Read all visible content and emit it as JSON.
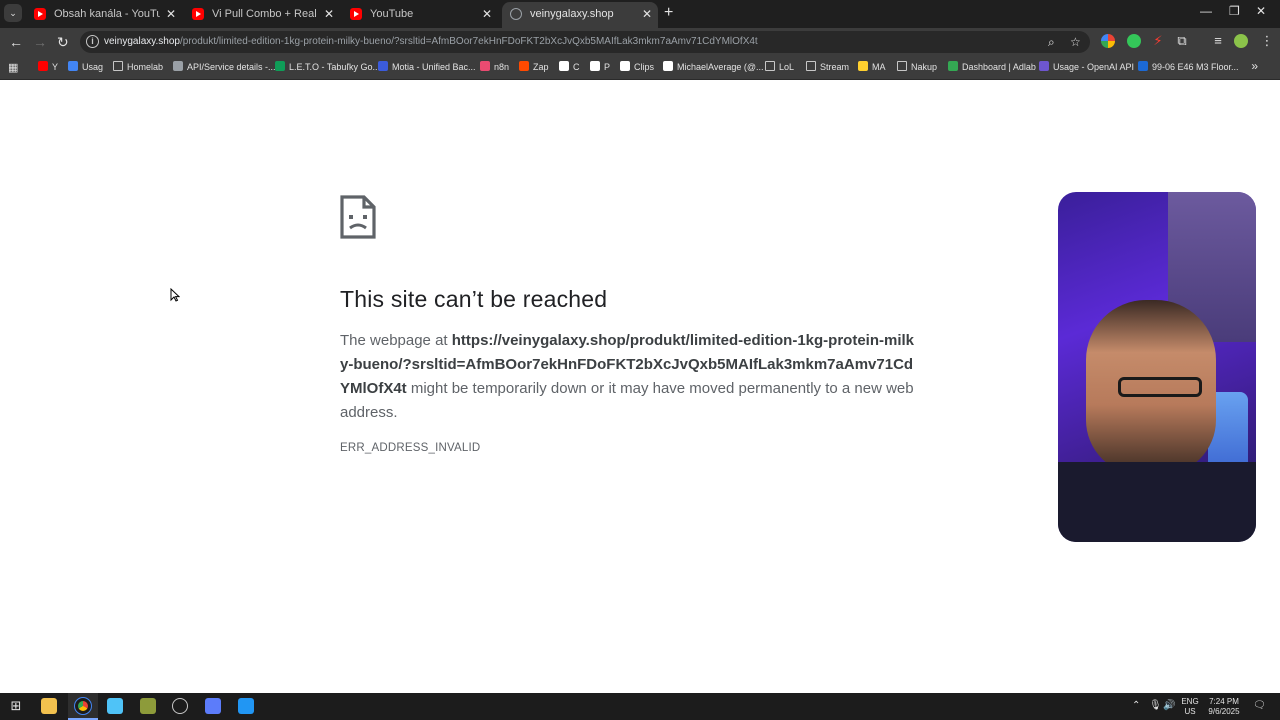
{
  "tabs": [
    {
      "title": "Obsah kanála - YouTube Studio",
      "icon": "youtube-icon"
    },
    {
      "title": "Vi Pull Combo + Real Talk - YouTube",
      "icon": "youtube-icon"
    },
    {
      "title": "YouTube",
      "icon": "youtube-icon"
    },
    {
      "title": "veinygalaxy.shop",
      "icon": "globe-icon",
      "active": true
    }
  ],
  "omnibox": {
    "host": "veinygalaxy.shop",
    "path": "/produkt/limited-edition-1kg-protein-milky-bueno/?srsltid=AfmBOor7ekHnFDoFKT2bXcJvQxb5MAIfLak3mkm7aAmv71CdYMlOfX4t"
  },
  "bookmarks": [
    {
      "label": "Y",
      "icon": "youtube-icon",
      "color": "#ff0000"
    },
    {
      "label": "Usag",
      "icon": "globe-icon",
      "color": "#4285f4"
    },
    {
      "label": "Homelab",
      "icon": "folder-icon"
    },
    {
      "label": "API/Service details -...",
      "icon": "gear-icon",
      "color": "#9aa0a6"
    },
    {
      "label": "L.E.T.O - Tabuľky Go...",
      "icon": "sheets-icon",
      "color": "#0f9d58"
    },
    {
      "label": "Motia - Unified Bac...",
      "icon": "motia-icon",
      "color": "#3b5bdb"
    },
    {
      "label": "n8n",
      "icon": "n8n-icon",
      "color": "#ea4b71"
    },
    {
      "label": "Zap",
      "icon": "zapier-icon",
      "color": "#ff4a00"
    },
    {
      "label": "C",
      "icon": "c-icon",
      "color": "#ffffff"
    },
    {
      "label": "P",
      "icon": "p-icon",
      "color": "#ffffff"
    },
    {
      "label": "Clips",
      "icon": "clips-icon",
      "color": "#ffffff"
    },
    {
      "label": "MichaelAverage (@...",
      "icon": "tiktok-icon",
      "color": "#ffffff"
    },
    {
      "label": "LoL",
      "icon": "folder-icon"
    },
    {
      "label": "Stream",
      "icon": "folder-icon"
    },
    {
      "label": "MA",
      "icon": "miro-icon",
      "color": "#ffd02f"
    },
    {
      "label": "Nakup",
      "icon": "folder-icon"
    },
    {
      "label": "Dashboard | Adlab",
      "icon": "adlab-icon",
      "color": "#34a853"
    },
    {
      "label": "Usage - OpenAI API",
      "icon": "openai-icon",
      "color": "#6e56cf"
    },
    {
      "label": "99-06 E46 M3 Floor...",
      "icon": "bmw-icon",
      "color": "#1c69d4"
    }
  ],
  "error": {
    "title": "This site can’t be reached",
    "desc_prefix": "The webpage at ",
    "url": "https://veinygalaxy.shop/produkt/limited-edition-1kg-protein-milky-bueno/?srsltid=AfmBOor7ekHnFDoFKT2bXcJvQxb5MAIfLak3mkm7aAmv71CdYMlOfX4t",
    "desc_suffix": " might be temporarily down or it may have moved permanently to a new web address.",
    "code": "ERR_ADDRESS_INVALID"
  },
  "taskbar": {
    "lang_top": "ENG",
    "lang_bottom": "US",
    "time": "7:24 PM",
    "date": "9/6/2025"
  },
  "colors": {
    "tabstrip": "#1f1f1f",
    "toolbar": "#3c3c3c",
    "taskbar": "#1c1c1c",
    "error_title": "#202124",
    "error_text": "#5f6368"
  }
}
